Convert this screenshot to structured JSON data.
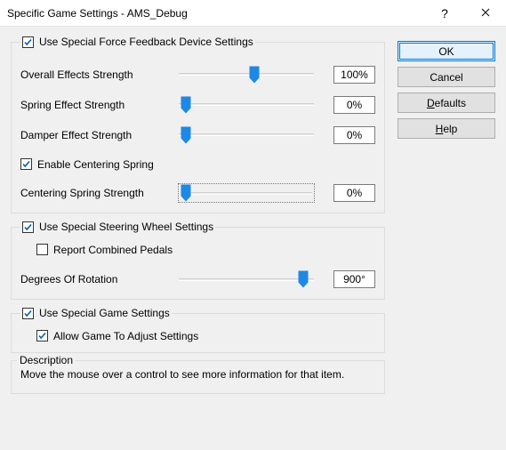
{
  "window": {
    "title": "Specific Game Settings - AMS_Debug"
  },
  "buttons": {
    "ok": "OK",
    "cancel": "Cancel",
    "defaults_pre": "D",
    "defaults_rest": "efaults",
    "help_pre": "H",
    "help_rest": "elp"
  },
  "ffb": {
    "use_special": {
      "label": "Use Special Force Feedback Device Settings",
      "checked": true
    },
    "overall": {
      "label": "Overall Effects Strength",
      "value": "100%",
      "pos": 56
    },
    "spring": {
      "label": "Spring Effect Strength",
      "value": "0%",
      "pos": 5
    },
    "damper": {
      "label": "Damper Effect Strength",
      "value": "0%",
      "pos": 5
    },
    "centering_enable": {
      "label": "Enable Centering Spring",
      "checked": true
    },
    "centering": {
      "label": "Centering Spring Strength",
      "value": "0%",
      "pos": 5
    }
  },
  "wheel": {
    "use_special": {
      "label": "Use Special Steering Wheel Settings",
      "checked": true
    },
    "combined": {
      "label": "Report Combined Pedals",
      "checked": false
    },
    "rotation": {
      "label": "Degrees Of Rotation",
      "value": "900°",
      "pos": 92
    }
  },
  "game": {
    "use_special": {
      "label": "Use Special Game Settings",
      "checked": true
    },
    "allow_adjust": {
      "label": "Allow Game To Adjust Settings",
      "checked": true
    }
  },
  "description": {
    "legend": "Description",
    "text": "Move the mouse over a control to see more information for that item."
  }
}
